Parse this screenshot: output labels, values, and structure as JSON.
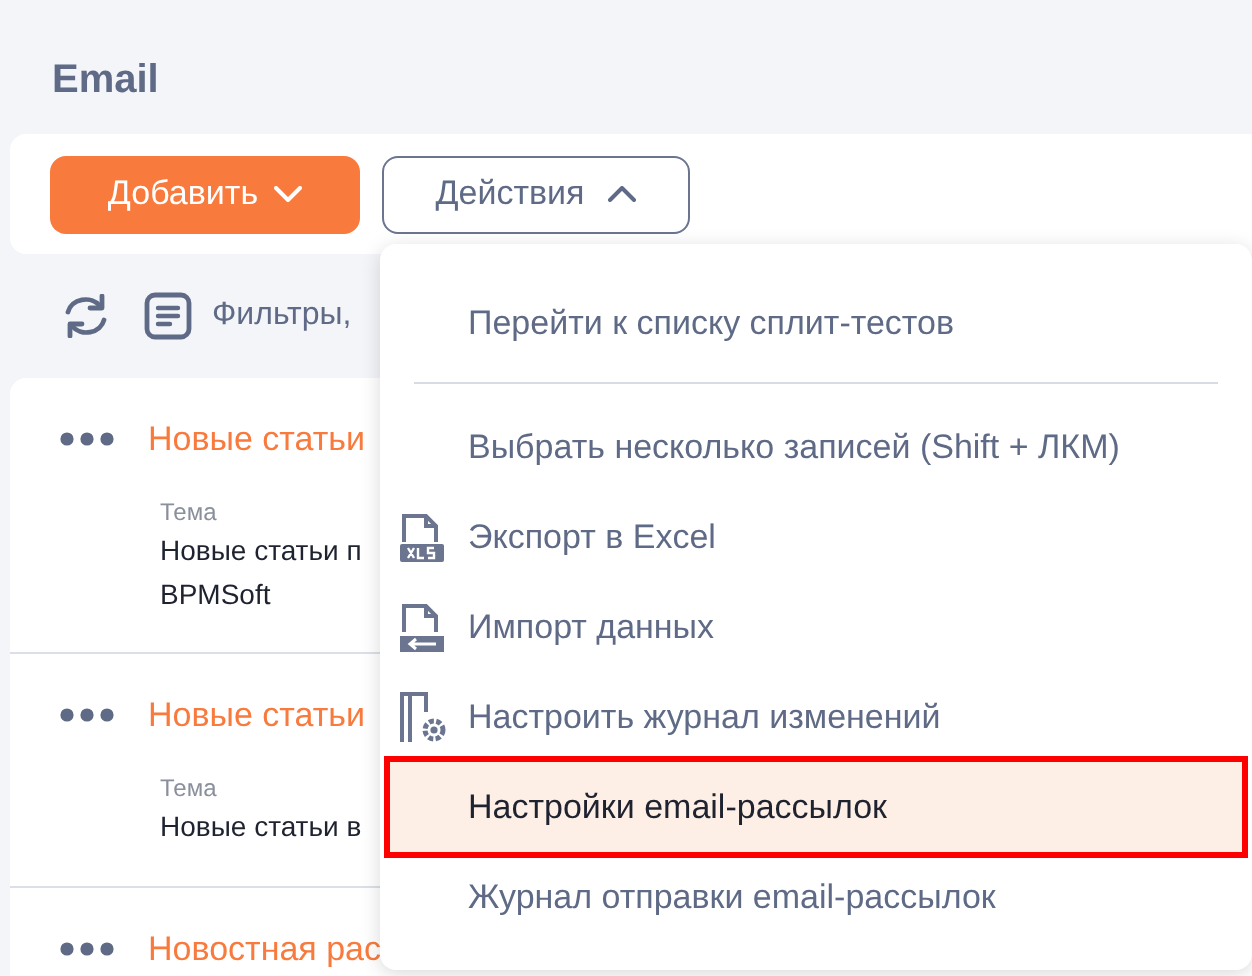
{
  "page_title": "Email",
  "toolbar": {
    "add_button": {
      "label": "Добавить"
    },
    "actions_button": {
      "label": "Действия",
      "expanded": true
    }
  },
  "filter_bar": {
    "filters_label": "Фильтры,"
  },
  "records": [
    {
      "title": "Новые статьи",
      "field_label": "Тема",
      "field_lines": [
        "Новые статьи п",
        "BPMSoft"
      ]
    },
    {
      "title": "Новые статьи",
      "field_label": "Тема",
      "field_lines": [
        "Новые статьи в"
      ]
    },
    {
      "title": "Новостная рас"
    }
  ],
  "actions_menu": {
    "groups": [
      [
        {
          "label": "Перейти к списку сплит-тестов",
          "kind": "plain",
          "selected": false
        }
      ],
      [
        {
          "label": "Выбрать несколько записей (Shift + ЛКМ)",
          "kind": "plain",
          "selected": false
        },
        {
          "label": "Экспорт в Excel",
          "kind": "xls",
          "selected": false
        },
        {
          "label": "Импорт данных",
          "kind": "import",
          "selected": false
        },
        {
          "label": "Настроить журнал изменений",
          "kind": "journal",
          "selected": false
        },
        {
          "label": "Настройки email-рассылок",
          "kind": "plain",
          "selected": true
        },
        {
          "label": "Журнал отправки email-рассылок",
          "kind": "plain",
          "selected": false
        }
      ]
    ]
  }
}
